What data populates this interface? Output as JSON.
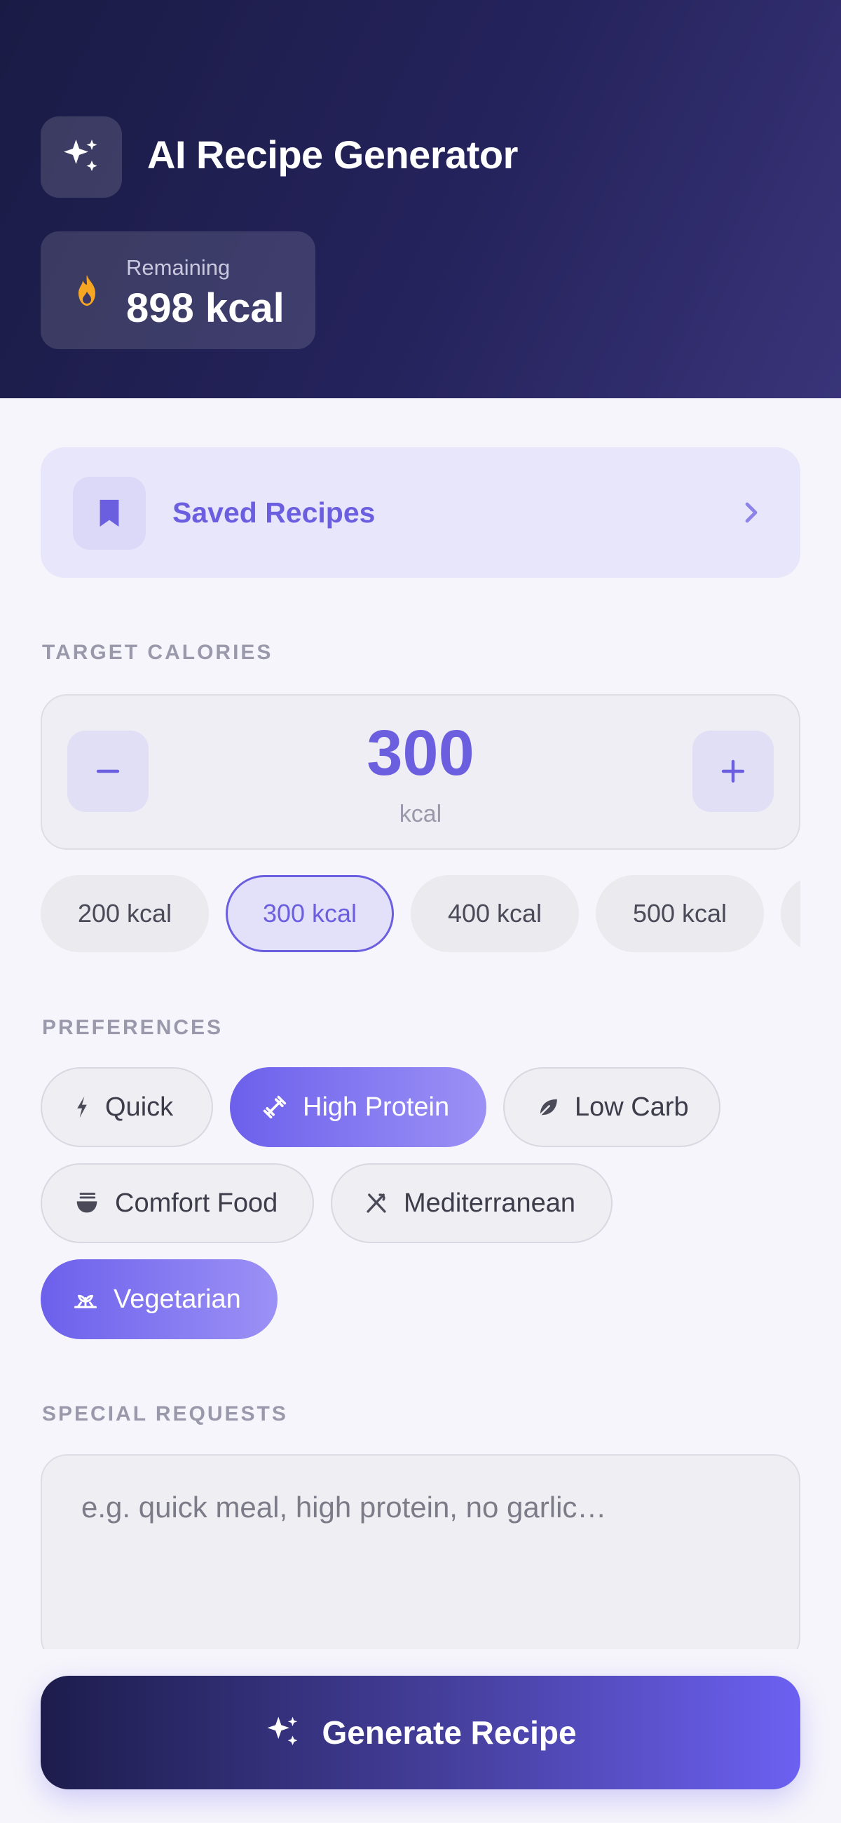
{
  "header": {
    "title": "AI Recipe Generator",
    "remaining_label": "Remaining",
    "remaining_value": "898 kcal",
    "icon": "sparkles-icon"
  },
  "saved_recipes": {
    "label": "Saved Recipes",
    "icon": "bookmark-icon"
  },
  "target_calories": {
    "section_label": "TARGET CALORIES",
    "value": "300",
    "unit": "kcal",
    "presets": [
      {
        "label": "200 kcal",
        "selected": false
      },
      {
        "label": "300 kcal",
        "selected": true
      },
      {
        "label": "400 kcal",
        "selected": false
      },
      {
        "label": "500 kcal",
        "selected": false
      },
      {
        "label": "",
        "selected": false
      }
    ]
  },
  "preferences": {
    "section_label": "PREFERENCES",
    "options": [
      {
        "label": "Quick",
        "icon": "lightning-icon",
        "selected": false
      },
      {
        "label": "High Protein",
        "icon": "dumbbell-icon",
        "selected": true
      },
      {
        "label": "Low Carb",
        "icon": "leaf-icon",
        "selected": false
      },
      {
        "label": "Comfort Food",
        "icon": "noodle-bowl-icon",
        "selected": false
      },
      {
        "label": "Mediterranean",
        "icon": "utensils-icon",
        "selected": false
      },
      {
        "label": "Vegetarian",
        "icon": "sprout-icon",
        "selected": true
      }
    ]
  },
  "special_requests": {
    "section_label": "SPECIAL REQUESTS",
    "placeholder": "e.g. quick meal, high protein, no garlic…"
  },
  "generate": {
    "label": "Generate Recipe"
  },
  "colors": {
    "accent": "#6b5fe0",
    "header_dark": "#1a1b45",
    "flame": "#f5a623"
  }
}
